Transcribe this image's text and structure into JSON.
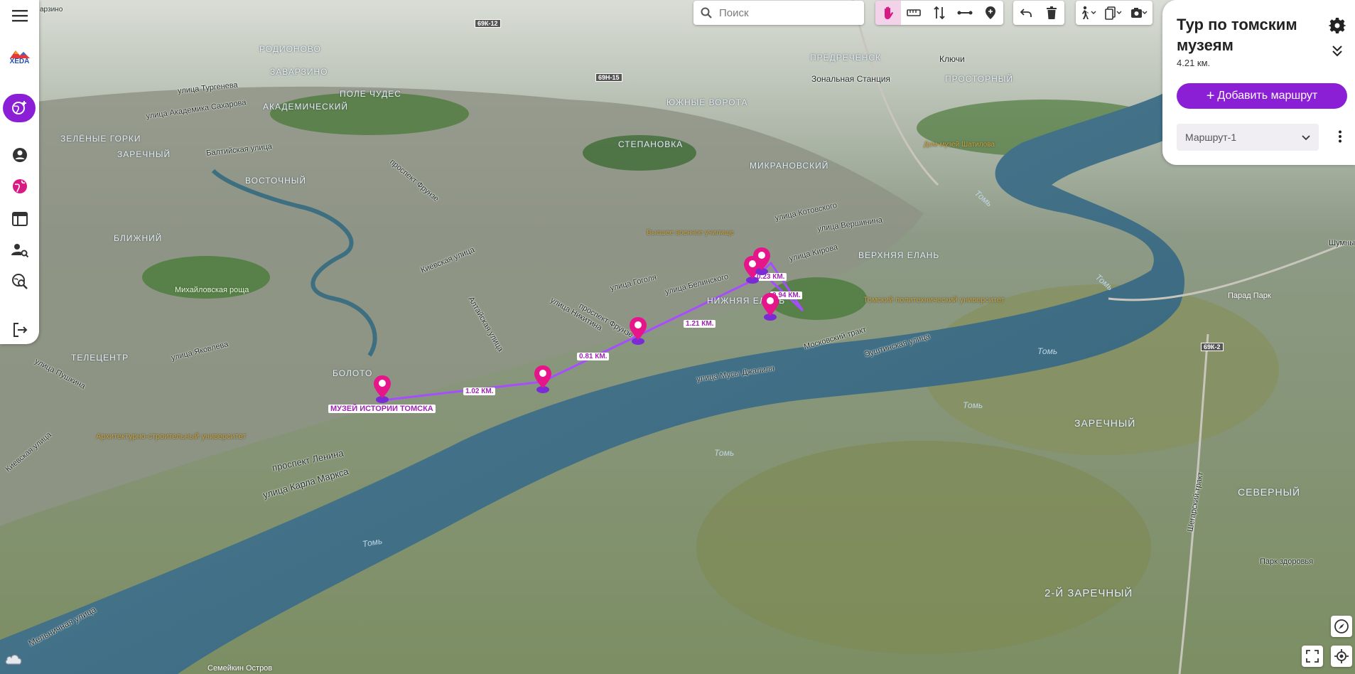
{
  "map": {
    "river_name": "Томь",
    "route_distances": [
      "1.02 КМ.",
      "0.81 КМ.",
      "1.21 КМ.",
      "0.23 КМ.",
      "0.94 КМ."
    ],
    "start_label": "МУЗЕЙ ИСТОРИИ ТОМСКА",
    "street_labels": [
      "улица Тургенева",
      "улица Академика Сахарова",
      "Балтийская улица",
      "проспект Фрунзе",
      "Киевская улица",
      "улица Гоголя",
      "улица Белинского",
      "улица Никитина",
      "проспект Фрунзе",
      "улица Яковлева",
      "улица Пушкина",
      "Алтайская улица",
      "улица Мусы Джалиля",
      "Московский тракт",
      "Эуштинская улица",
      "проспект Ленина",
      "улица Карла Маркса",
      "Мельничная улица",
      "улица Котовского",
      "улица Вершинина",
      "улица Кирова",
      "Шегарский тракт",
      "Киевская улица"
    ],
    "district_labels": [
      "РОДИОНОВО",
      "ЗАВАРЗИНО",
      "ЗЕЛЁНЫЕ ГОРКИ",
      "ЗАРЕЧНЫЙ",
      "АКАДЕМИЧЕСКИЙ",
      "ПОЛЕ ЧУДЕС",
      "ВОСТОЧНЫЙ",
      "БЛИЖНИЙ",
      "ТЕЛЕЦЕНТР",
      "БОЛОТО",
      "ЮЖНЫЕ ВОРОТА",
      "СТЕПАНОВКА",
      "МИКРАНОВСКИЙ",
      "ПРЕДРЕЧЕНСК",
      "ПРОСТОРНЫЙ",
      "НИЖНЯЯ ЕЛАНЬ",
      "ВЕРХНЯЯ ЕЛАНЬ",
      "ЗАРЕЧНЫЙ",
      "СЕВЕРНЫЙ",
      "2-Й ЗАРЕЧНЫЙ"
    ],
    "place_labels": [
      "Ключи",
      "Зональная Станция",
      "Михайловская роща",
      "Архитектурно-строительный университет",
      "Томский политехнический университет",
      "Парк здоровья",
      "Парад Парк",
      "Семейкин Остров",
      "Дом-музей Шатилова",
      "Высшее военное училище",
      "Шумный"
    ],
    "road_badges": [
      "69К-12",
      "69Н-15",
      "69К-2"
    ],
    "top_left_fragment": "арзино"
  },
  "sidebar": {
    "logo_text": "XEDA",
    "items": [
      "menu",
      "globe-add",
      "profile",
      "globe",
      "table",
      "user-search",
      "search-globe",
      "logout"
    ]
  },
  "toolbar": {
    "search_placeholder": "Поиск"
  },
  "panel": {
    "title": "Тур по томским музеям",
    "distance": "4.21 км.",
    "add_route_label": "Добавить маршрут",
    "route_selected": "Маршрут-1"
  },
  "colors": {
    "accent": "#8b1fd6",
    "marker": "#e6158a",
    "route": "#a64dff",
    "river": "#3f6f86"
  }
}
